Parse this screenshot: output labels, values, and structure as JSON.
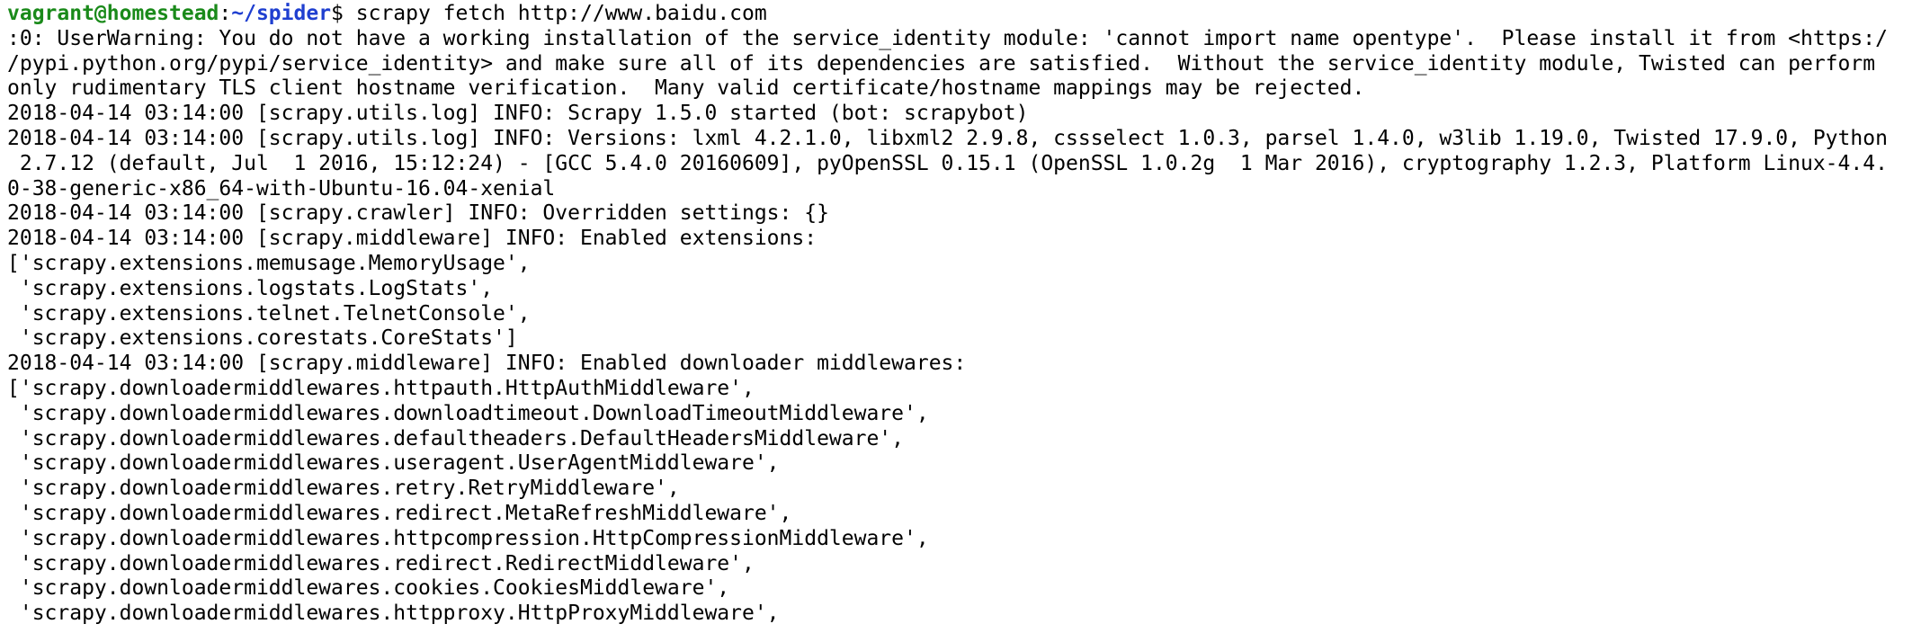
{
  "terminal": {
    "prompt": {
      "user_host": "vagrant@homestead",
      "separator": ":",
      "path": "~/spider",
      "symbol": "$",
      "command": " scrapy fetch http://www.baidu.com"
    },
    "lines": [
      ":0: UserWarning: You do not have a working installation of the service_identity module: 'cannot import name opentype'.  Please install it from <https:/",
      "/pypi.python.org/pypi/service_identity> and make sure all of its dependencies are satisfied.  Without the service_identity module, Twisted can perform",
      "only rudimentary TLS client hostname verification.  Many valid certificate/hostname mappings may be rejected.",
      "2018-04-14 03:14:00 [scrapy.utils.log] INFO: Scrapy 1.5.0 started (bot: scrapybot)",
      "2018-04-14 03:14:00 [scrapy.utils.log] INFO: Versions: lxml 4.2.1.0, libxml2 2.9.8, cssselect 1.0.3, parsel 1.4.0, w3lib 1.19.0, Twisted 17.9.0, Python",
      " 2.7.12 (default, Jul  1 2016, 15:12:24) - [GCC 5.4.0 20160609], pyOpenSSL 0.15.1 (OpenSSL 1.0.2g  1 Mar 2016), cryptography 1.2.3, Platform Linux-4.4.",
      "0-38-generic-x86_64-with-Ubuntu-16.04-xenial",
      "2018-04-14 03:14:00 [scrapy.crawler] INFO: Overridden settings: {}",
      "2018-04-14 03:14:00 [scrapy.middleware] INFO: Enabled extensions:",
      "['scrapy.extensions.memusage.MemoryUsage',",
      " 'scrapy.extensions.logstats.LogStats',",
      " 'scrapy.extensions.telnet.TelnetConsole',",
      " 'scrapy.extensions.corestats.CoreStats']",
      "2018-04-14 03:14:00 [scrapy.middleware] INFO: Enabled downloader middlewares:",
      "['scrapy.downloadermiddlewares.httpauth.HttpAuthMiddleware',",
      " 'scrapy.downloadermiddlewares.downloadtimeout.DownloadTimeoutMiddleware',",
      " 'scrapy.downloadermiddlewares.defaultheaders.DefaultHeadersMiddleware',",
      " 'scrapy.downloadermiddlewares.useragent.UserAgentMiddleware',",
      " 'scrapy.downloadermiddlewares.retry.RetryMiddleware',",
      " 'scrapy.downloadermiddlewares.redirect.MetaRefreshMiddleware',",
      " 'scrapy.downloadermiddlewares.httpcompression.HttpCompressionMiddleware',",
      " 'scrapy.downloadermiddlewares.redirect.RedirectMiddleware',",
      " 'scrapy.downloadermiddlewares.cookies.CookiesMiddleware',",
      " 'scrapy.downloadermiddlewares.httpproxy.HttpProxyMiddleware',"
    ],
    "colors": {
      "background": "#ffffff",
      "text": "#000000",
      "prompt_user": "#1a8a1a",
      "prompt_path": "#1f3fd0"
    }
  }
}
